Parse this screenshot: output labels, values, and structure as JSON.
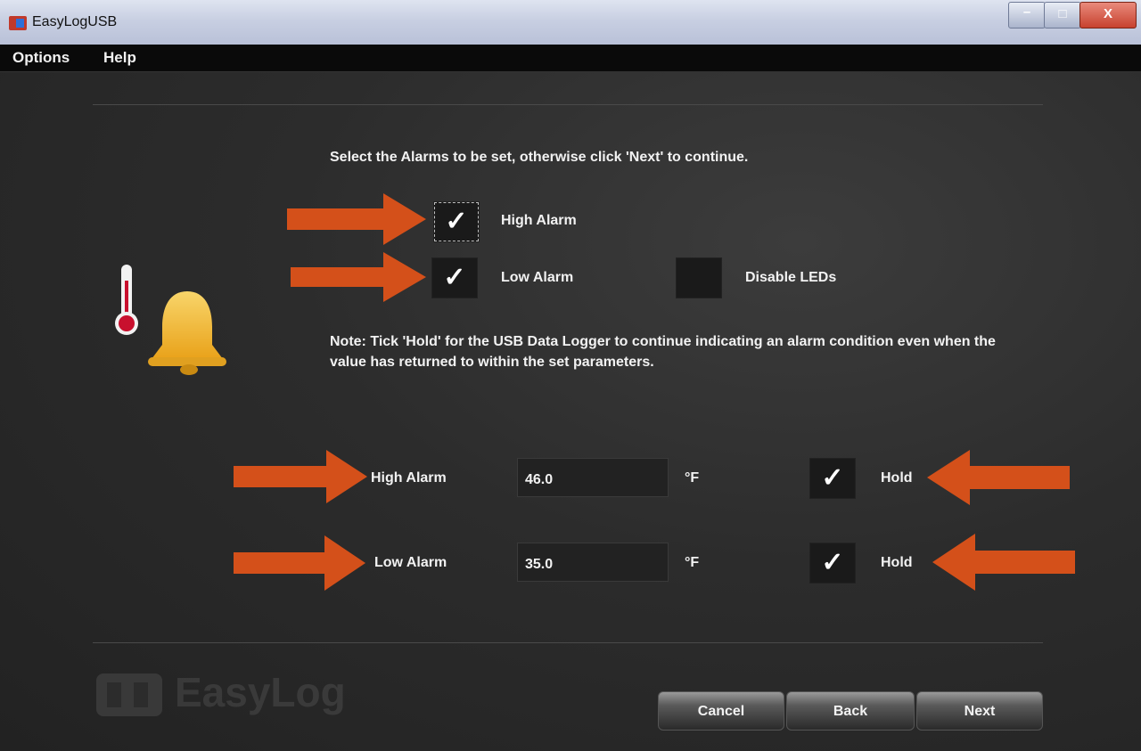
{
  "window": {
    "title": "EasyLogUSB",
    "min_glyph": "–",
    "max_glyph": "□",
    "close_glyph": "X"
  },
  "menu": {
    "items": [
      "Options",
      "Help"
    ]
  },
  "main": {
    "instruction": "Select the Alarms to be set, otherwise click 'Next' to continue.",
    "checkboxes": {
      "high_alarm": {
        "label": "High Alarm",
        "checked": true
      },
      "low_alarm": {
        "label": "Low Alarm",
        "checked": true
      },
      "disable_leds": {
        "label": "Disable LEDs",
        "checked": false
      }
    },
    "note": "Note: Tick 'Hold' for the USB Data Logger to continue indicating an alarm condition even when the value has returned to within the set parameters.",
    "thresholds": [
      {
        "label": "High Alarm",
        "value": "46.0",
        "unit": "°F",
        "hold_label": "Hold",
        "hold_checked": true
      },
      {
        "label": "Low Alarm",
        "value": "35.0",
        "unit": "°F",
        "hold_label": "Hold",
        "hold_checked": true
      }
    ]
  },
  "footer": {
    "logo_text": "EasyLog",
    "buttons": {
      "cancel": "Cancel",
      "back": "Back",
      "next": "Next"
    }
  },
  "check_glyph": "✓",
  "colors": {
    "arrow": "#d4501a",
    "bell": "#f3b62b",
    "thermometer_bulb": "#c8102e"
  },
  "icons": [
    "thermometer-icon",
    "bell-icon",
    "arrow-right-icon",
    "arrow-left-icon",
    "easylog-logo-icon"
  ]
}
